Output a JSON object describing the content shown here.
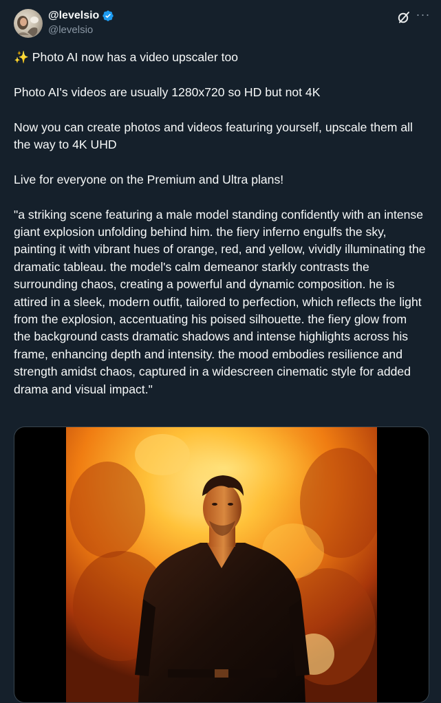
{
  "author": {
    "display_name": "@levelsio",
    "handle": "@levelsio",
    "verified_color": "#1d9bf0"
  },
  "actions": {
    "grok_icon": "grok-slash-icon",
    "more_icon": "more-horizontal-icon",
    "more_label": "···"
  },
  "tweet": {
    "paragraphs": [
      "✨ Photo AI now has a video upscaler too",
      "Photo AI's videos are usually 1280x720 so HD but not 4K",
      "Now you can create photos and videos featuring yourself, upscale them all the way to 4K UHD",
      "Live for everyone on the Premium and Ultra plans!",
      "\"a striking scene featuring a male model standing confidently with an intense giant explosion unfolding behind him. the fiery inferno engulfs the sky, painting it with vibrant hues of orange, red, and yellow, vividly illuminating the dramatic tableau. the model's calm demeanor starkly contrasts the surrounding chaos, creating a powerful and dynamic composition. he is attired in a sleek, modern outfit, tailored to perfection, which reflects the light from the explosion, accentuating his poised silhouette. the fiery glow from the background casts dramatic shadows and intense highlights across his frame, enhancing depth and intensity. the mood embodies resilience and strength amidst chaos, captured in a widescreen cinematic style for added drama and visual impact.\""
    ]
  },
  "media": {
    "type": "video",
    "subject": "man-in-front-of-explosion"
  },
  "colors": {
    "background": "#15202b",
    "text": "#f7f9f9",
    "secondary_text": "#8b98a5",
    "media_letterbox": "#000000",
    "fire_orange": "#ff8a1a",
    "fire_yellow": "#ffd24a",
    "fire_red": "#c2410c"
  }
}
